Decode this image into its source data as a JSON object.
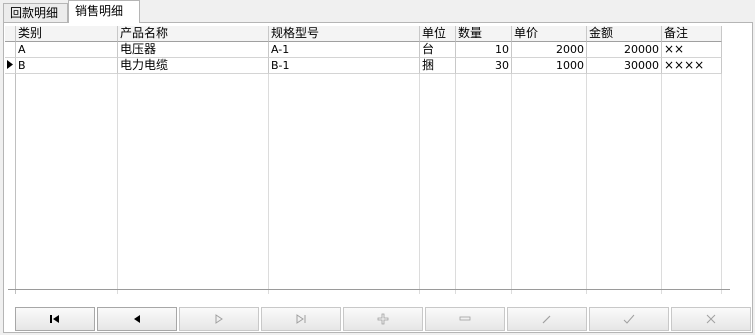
{
  "tabs": [
    {
      "label": "回款明细",
      "active": false
    },
    {
      "label": "销售明细",
      "active": true
    }
  ],
  "grid": {
    "columns": [
      "类别",
      "产品名称",
      "规格型号",
      "单位",
      "数量",
      "单价",
      "金额",
      "备注"
    ],
    "rows": [
      {
        "category": "A",
        "product": "电压器",
        "spec": "A-1",
        "unit": "台",
        "qty": "10",
        "price": "2000",
        "amount": "20000",
        "remark": "××"
      },
      {
        "category": "B",
        "product": "电力电缆",
        "spec": "B-1",
        "unit": "捆",
        "qty": "30",
        "price": "1000",
        "amount": "30000",
        "remark": "××××"
      }
    ],
    "current_row": 1
  },
  "navigator": {
    "buttons": [
      {
        "name": "first",
        "icon": "first-record-icon",
        "enabled": true
      },
      {
        "name": "prior",
        "icon": "prior-record-icon",
        "enabled": true
      },
      {
        "name": "next",
        "icon": "next-record-icon",
        "enabled": false
      },
      {
        "name": "last",
        "icon": "last-record-icon",
        "enabled": false
      },
      {
        "name": "insert",
        "icon": "insert-record-icon",
        "enabled": false
      },
      {
        "name": "delete",
        "icon": "delete-record-icon",
        "enabled": false
      },
      {
        "name": "edit",
        "icon": "edit-record-icon",
        "enabled": false
      },
      {
        "name": "post",
        "icon": "post-record-icon",
        "enabled": false
      },
      {
        "name": "cancel",
        "icon": "cancel-edit-icon",
        "enabled": false
      }
    ]
  },
  "colors": {
    "enabled_icon": "#000000",
    "disabled_icon": "#a0a0a0"
  }
}
